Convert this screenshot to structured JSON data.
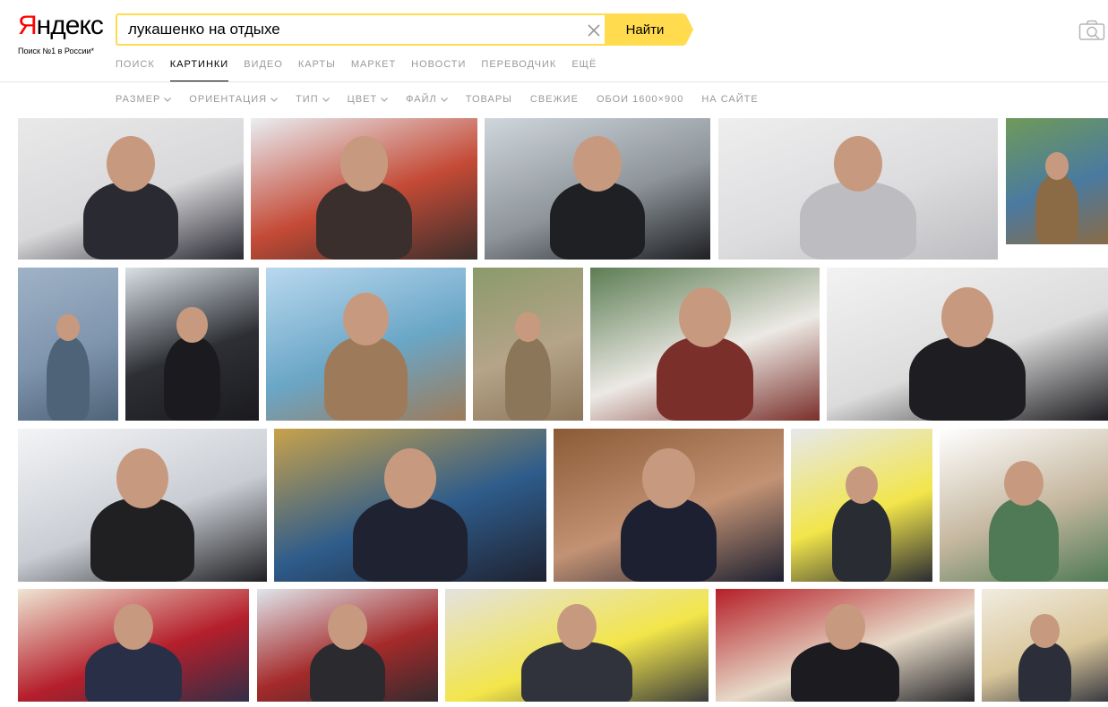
{
  "logo": {
    "first_letter": "Я",
    "rest": "ндекс",
    "tagline": "Поиск №1 в России*"
  },
  "search": {
    "query": "лукашенко на отдыхе",
    "button_label": "Найти"
  },
  "nav": [
    {
      "label": "ПОИСК",
      "active": false
    },
    {
      "label": "КАРТИНКИ",
      "active": true
    },
    {
      "label": "ВИДЕО",
      "active": false
    },
    {
      "label": "КАРТЫ",
      "active": false
    },
    {
      "label": "МАРКЕТ",
      "active": false
    },
    {
      "label": "НОВОСТИ",
      "active": false
    },
    {
      "label": "ПЕРЕВОДЧИК",
      "active": false
    },
    {
      "label": "ЕЩЁ",
      "active": false
    }
  ],
  "filters": [
    {
      "label": "РАЗМЕР",
      "dropdown": true
    },
    {
      "label": "ОРИЕНТАЦИЯ",
      "dropdown": true
    },
    {
      "label": "ТИП",
      "dropdown": true
    },
    {
      "label": "ЦВЕТ",
      "dropdown": true
    },
    {
      "label": "ФАЙЛ",
      "dropdown": true
    },
    {
      "label": "ТОВАРЫ",
      "dropdown": false
    },
    {
      "label": "СВЕЖИЕ",
      "dropdown": false
    },
    {
      "label": "ОБОИ 1600×900",
      "dropdown": false
    },
    {
      "label": "НА САЙТЕ",
      "dropdown": false
    }
  ],
  "colors": {
    "accent_yellow": "#ffdb4d",
    "logo_red": "#ff0000",
    "nav_gray": "#999999"
  },
  "icons": {
    "clear": "close-icon",
    "camera": "camera-search-icon",
    "dropdown": "chevron-down-icon"
  },
  "results": [
    {
      "scene": "official-indoor",
      "palette": [
        "#e9e9ea",
        "#d8d8da",
        "#2a2a33"
      ]
    },
    {
      "scene": "ski-cafe",
      "palette": [
        "#e9eef3",
        "#c44a36",
        "#3a2f2c"
      ]
    },
    {
      "scene": "airport",
      "palette": [
        "#cfd6dc",
        "#8d949a",
        "#1f2023"
      ]
    },
    {
      "scene": "snow-slope",
      "palette": [
        "#eeeeef",
        "#dcdcde",
        "#bdbdc1"
      ]
    },
    {
      "scene": "field-green",
      "palette": [
        "#6f9a59",
        "#4a7aa0",
        "#8a6b46"
      ]
    },
    {
      "scene": "water",
      "palette": [
        "#9fb2c6",
        "#7f95ae",
        "#4f6378"
      ]
    },
    {
      "scene": "winter-forest",
      "palette": [
        "#d9e0e6",
        "#2d2f34",
        "#1b1b1f"
      ]
    },
    {
      "scene": "potato-field",
      "palette": [
        "#b9d8ef",
        "#6aa6c6",
        "#9d7b5a"
      ]
    },
    {
      "scene": "potato-field-2",
      "palette": [
        "#8a9a6a",
        "#b5a489",
        "#8c7659"
      ]
    },
    {
      "scene": "crowd-outdoor",
      "palette": [
        "#5c7d53",
        "#ece9e4",
        "#7a2f2a"
      ]
    },
    {
      "scene": "ski-goggles",
      "palette": [
        "#f2f2f2",
        "#dcdcdc",
        "#1e1e22"
      ]
    },
    {
      "scene": "snow-ski-duo",
      "palette": [
        "#f3f4f6",
        "#c9cdd3",
        "#202023"
      ]
    },
    {
      "scene": "press-conference",
      "palette": [
        "#c8a24b",
        "#2e5c8b",
        "#1f2230"
      ]
    },
    {
      "scene": "portrait-closeup",
      "palette": [
        "#8b5a35",
        "#c39274",
        "#1c2030"
      ]
    },
    {
      "scene": "ski-race",
      "palette": [
        "#e6e8ec",
        "#f2e54a",
        "#2a2c33"
      ]
    },
    {
      "scene": "beach-zoom",
      "palette": [
        "#ffffff",
        "#c5b79f",
        "#4f7a55"
      ]
    },
    {
      "scene": "meeting-flags",
      "palette": [
        "#efe6d3",
        "#b51f2b",
        "#2a2f48"
      ]
    },
    {
      "scene": "winter-duo",
      "palette": [
        "#dfe6ec",
        "#a52a2a",
        "#2b2b2f"
      ]
    },
    {
      "scene": "ski-race-2",
      "palette": [
        "#e4e2e0",
        "#f2e54a",
        "#30333b"
      ]
    },
    {
      "scene": "red-hall",
      "palette": [
        "#b51f27",
        "#e7dac8",
        "#1c1c20"
      ]
    },
    {
      "scene": "palace-meeting",
      "palette": [
        "#f1ece0",
        "#d9c69a",
        "#2c2f3a"
      ]
    }
  ]
}
